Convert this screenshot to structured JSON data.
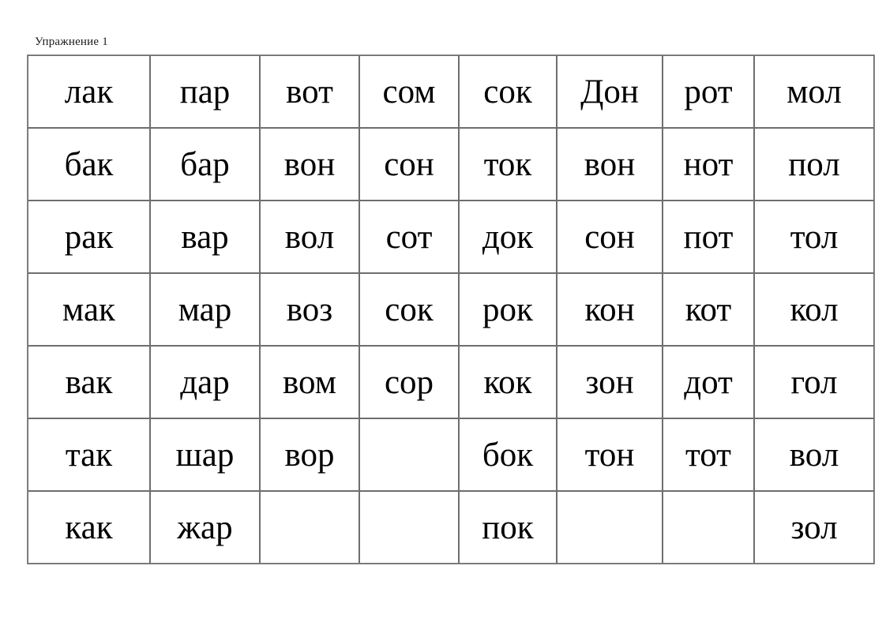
{
  "page": {
    "title": "Упражнение 1",
    "background_color": "#ffffff",
    "text_color": "#000000",
    "grid_border_color": "#6e6e6e"
  },
  "grid": {
    "rows": 7,
    "columns": 8,
    "cells": [
      [
        "лак",
        "пар",
        "вот",
        "сом",
        "сок",
        "Дон",
        "рот",
        "мол"
      ],
      [
        "бак",
        "бар",
        "вон",
        "сон",
        "ток",
        "вон",
        "нот",
        "пол"
      ],
      [
        "рак",
        "вар",
        "вол",
        "сот",
        "док",
        "сон",
        "пот",
        "тол"
      ],
      [
        "мак",
        "мар",
        "воз",
        "сок",
        "рок",
        "кон",
        "кот",
        "кол"
      ],
      [
        "вак",
        "дар",
        "вом",
        "сор",
        "кок",
        "зон",
        "дот",
        "гол"
      ],
      [
        "так",
        "шар",
        "вор",
        "",
        "бок",
        "тон",
        "тот",
        "вол"
      ],
      [
        "как",
        "жар",
        "",
        "",
        "пок",
        "",
        "",
        "зол"
      ]
    ]
  }
}
